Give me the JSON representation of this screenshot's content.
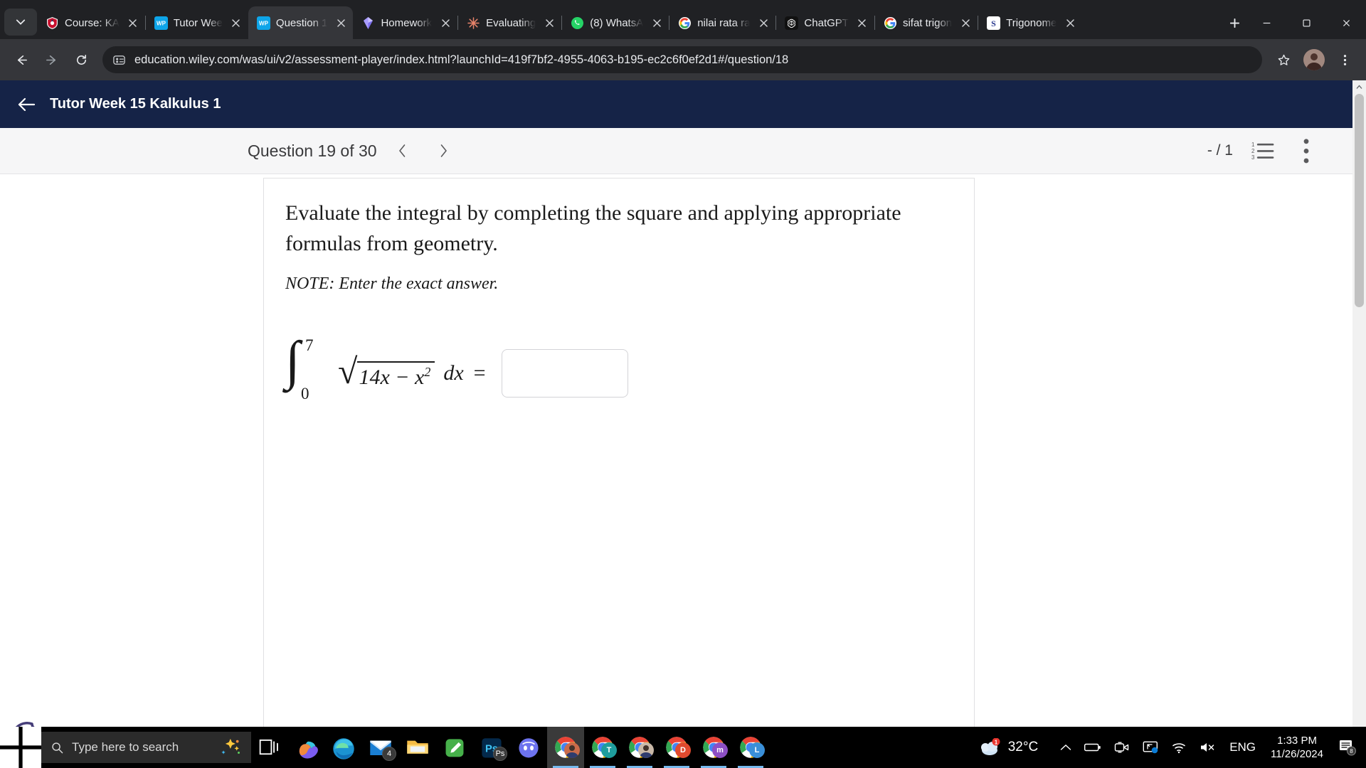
{
  "browser": {
    "tabs": [
      {
        "title": "Course: KA",
        "favicon": "shield-icon",
        "active": false
      },
      {
        "title": "Tutor Wee",
        "favicon": "wiley-icon",
        "active": false
      },
      {
        "title": "Question 1",
        "favicon": "wiley-icon",
        "active": true
      },
      {
        "title": "Homework",
        "favicon": "gem-icon",
        "active": false
      },
      {
        "title": "Evaluating",
        "favicon": "claude-icon",
        "active": false
      },
      {
        "title": "(8) WhatsA",
        "favicon": "whatsapp-icon",
        "active": false
      },
      {
        "title": "nilai rata ra",
        "favicon": "google-icon",
        "active": false
      },
      {
        "title": "ChatGPT",
        "favicon": "openai-icon",
        "active": false
      },
      {
        "title": "sifat trigon",
        "favicon": "google-icon",
        "active": false
      },
      {
        "title": "Trigonome",
        "favicon": "symbolab-icon",
        "active": false
      }
    ],
    "new_tab_label": "+",
    "url": "education.wiley.com/was/ui/v2/assessment-player/index.html?launchId=419f7bf2-4955-4063-b195-ec2c6f0ef2d1#/question/18",
    "toolbar_icons": [
      "back-icon",
      "forward-icon",
      "reload-icon",
      "site-settings-icon",
      "bookmark-star-icon",
      "profile-avatar-icon",
      "browser-menu-icon"
    ],
    "window_controls": [
      "minimize-icon",
      "maximize-icon",
      "close-icon"
    ]
  },
  "wiley": {
    "header_title": "Tutor Week 15 Kalkulus 1",
    "back_label": "back-arrow",
    "question_label": "Question 19 of 30",
    "prev_label": "‹",
    "next_label": "›",
    "score": "- / 1",
    "list_icon": "numbered-list-icon",
    "menu_icon": "more-options-icon"
  },
  "question": {
    "prompt": "Evaluate the integral by completing the square and applying appropriate formulas from geometry.",
    "note": "NOTE: Enter the exact answer.",
    "math": {
      "integral_glyph": "∫",
      "upper_limit": "7",
      "lower_limit": "0",
      "radical_sign": "√",
      "radicand": "14x − x",
      "radicand_exponent": "2",
      "differential": "dx",
      "equals": "=",
      "answer_value": "",
      "answer_placeholder": ""
    }
  },
  "cookie_widget": {
    "name": "cookie-consent-icon"
  },
  "taskbar": {
    "search_placeholder": "Type here to search",
    "apps": [
      {
        "name": "task-view",
        "label": ""
      },
      {
        "name": "copilot",
        "label": ""
      },
      {
        "name": "microsoft-edge",
        "label": ""
      },
      {
        "name": "mail",
        "label": "4"
      },
      {
        "name": "file-explorer",
        "label": ""
      },
      {
        "name": "onenote",
        "label": ""
      },
      {
        "name": "photoshop",
        "label": "Ps"
      },
      {
        "name": "discord",
        "label": ""
      },
      {
        "name": "chrome-profile-1",
        "label": ""
      },
      {
        "name": "chrome-profile-t",
        "label": "T"
      },
      {
        "name": "chrome-profile-2",
        "label": ""
      },
      {
        "name": "chrome-profile-d",
        "label": "D"
      },
      {
        "name": "chrome-profile-m",
        "label": "m"
      },
      {
        "name": "chrome-profile-l",
        "label": "L"
      }
    ],
    "tray": {
      "weather_temp": "32°C",
      "weather_badge": "1",
      "language": "ENG",
      "time": "1:33 PM",
      "date": "11/26/2024",
      "notification_count": "8",
      "icons": [
        "show-hidden-icons-chevron",
        "battery-icon",
        "camera-icon",
        "screen-share-icon",
        "wifi-icon",
        "volume-muted-icon"
      ]
    }
  },
  "colors": {
    "wiley_navy": "#152347",
    "chrome_dark": "#202124",
    "chrome_toolbar": "#35363a",
    "taskbar_black": "#000000",
    "page_bg": "#f6f6f7"
  }
}
